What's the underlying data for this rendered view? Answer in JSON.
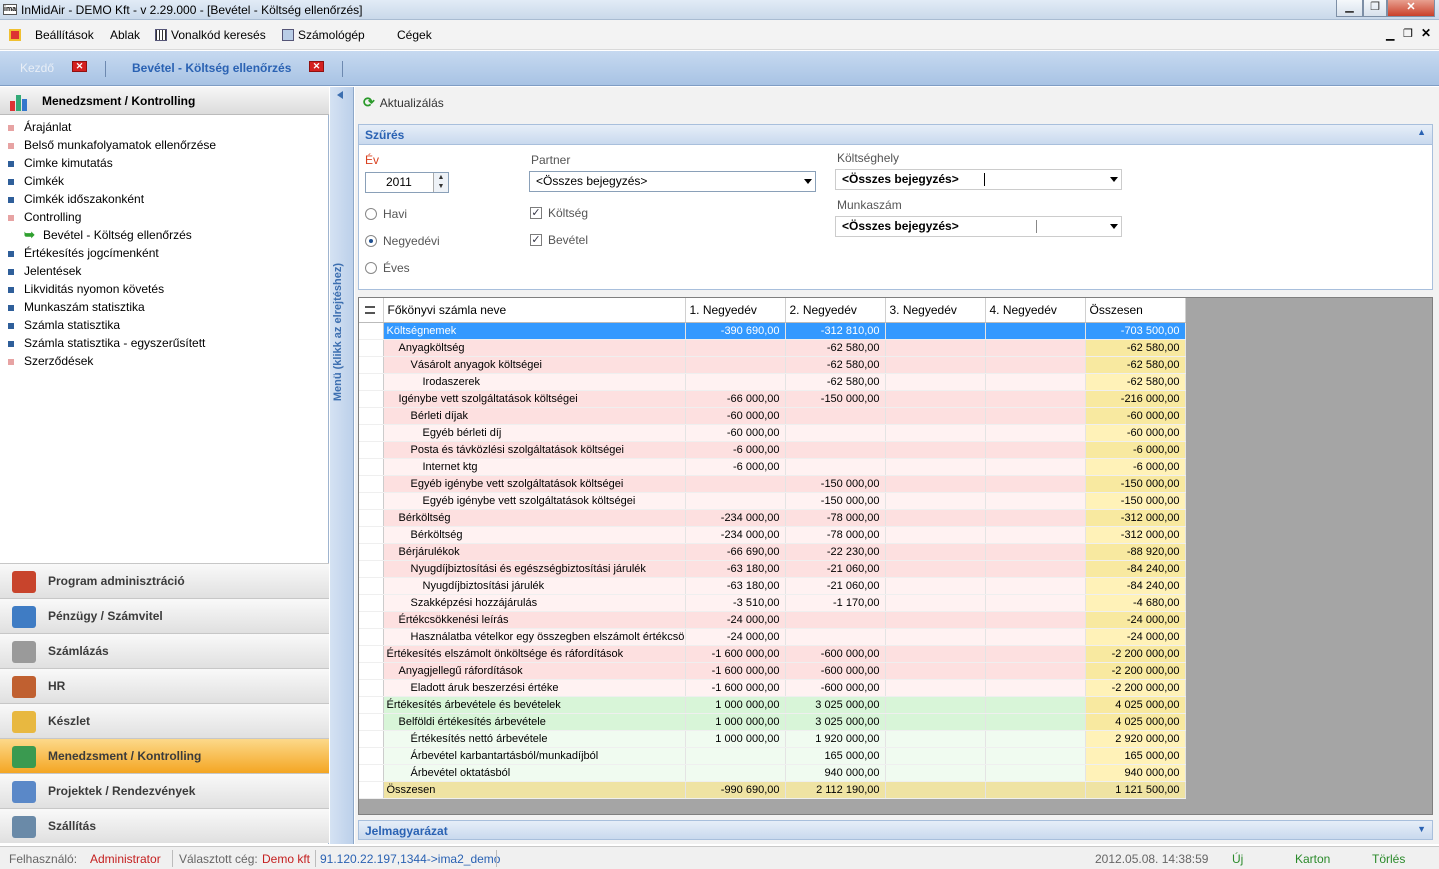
{
  "window": {
    "title": "InMidAir - DEMO Kft - v 2.29.000 - [Bevétel - Költség ellenőrzés]",
    "logo": "ima"
  },
  "menu": {
    "items": [
      "Beállítások",
      "Ablak",
      "Vonalkód keresés",
      "Számológép",
      "Cégek"
    ]
  },
  "tabs": [
    {
      "label": "Kezdő",
      "active": false
    },
    {
      "label": "Bevétel - Költség ellenőrzés",
      "active": true
    }
  ],
  "left": {
    "header": "Menedzsment / Kontrolling",
    "items": [
      {
        "label": "Árajánlat",
        "color": "#e7a3a3"
      },
      {
        "label": "Belső munkafolyamatok ellenőrzése",
        "color": "#e7a3a3"
      },
      {
        "label": "Cimke kimutatás",
        "color": "#2f5f9a"
      },
      {
        "label": "Cimkék",
        "color": "#2f5f9a"
      },
      {
        "label": "Cimkék időszakonként",
        "color": "#2f5f9a"
      },
      {
        "label": "Controlling",
        "color": "#e7a3a3"
      },
      {
        "label": "Bevétel - Költség ellenőrzés",
        "color": "#2fa02f"
      },
      {
        "label": "Értékesítés jogcímenként",
        "color": "#2f5f9a"
      },
      {
        "label": "Jelentések",
        "color": "#2f5f9a"
      },
      {
        "label": "Likviditás nyomon követés",
        "color": "#2f5f9a"
      },
      {
        "label": "Munkaszám statisztika",
        "color": "#2f5f9a"
      },
      {
        "label": "Számla statisztika",
        "color": "#2f5f9a"
      },
      {
        "label": "Számla statisztika - egyszerűsített",
        "color": "#2f5f9a"
      },
      {
        "label": "Szerződések",
        "color": "#e7a3a3"
      }
    ],
    "modules": [
      {
        "label": "Program adminisztráció",
        "icon": "home-icon",
        "active": false
      },
      {
        "label": "Pénzügy / Számvitel",
        "icon": "calculator-icon",
        "active": false
      },
      {
        "label": "Számlázás",
        "icon": "invoice-icon",
        "active": false
      },
      {
        "label": "HR",
        "icon": "people-icon",
        "active": false
      },
      {
        "label": "Készlet",
        "icon": "box-icon",
        "active": false
      },
      {
        "label": "Menedzsment / Kontrolling",
        "icon": "chart-icon",
        "active": true
      },
      {
        "label": "Projektek / Rendezvények",
        "icon": "project-icon",
        "active": false
      },
      {
        "label": "Szállítás",
        "icon": "truck-icon",
        "active": false
      }
    ]
  },
  "side_strip": "Menü (klikk az elrejtéshez)",
  "toolbar": {
    "refresh": "Aktualizálás"
  },
  "filter": {
    "title": "Szűrés",
    "year_label": "Év",
    "year_value": "2011",
    "partner_label": "Partner",
    "partner_value": "<Összes bejegyzés>",
    "ktghely_label": "Költséghely",
    "ktghely_value": "<Összes bejegyzés>",
    "munkaszam_label": "Munkaszám",
    "munkaszam_value": "<Összes bejegyzés>",
    "periods": [
      {
        "label": "Havi",
        "selected": false
      },
      {
        "label": "Negyedévi",
        "selected": true
      },
      {
        "label": "Éves",
        "selected": false
      }
    ],
    "checks": [
      {
        "label": "Költség",
        "checked": true
      },
      {
        "label": "Bevétel",
        "checked": true
      }
    ]
  },
  "grid": {
    "columns": [
      "Főkönyvi számla neve",
      "1. Negyedév",
      "2. Negyedév",
      "3. Negyedév",
      "4. Negyedév",
      "Összesen"
    ],
    "rows": [
      {
        "name": "Költségnemek",
        "lvl": 0,
        "q1": "-390 690,00",
        "q2": "-312 810,00",
        "q3": "",
        "q4": "",
        "sum": "-703 500,00",
        "style": "sel"
      },
      {
        "name": "Anyagköltség",
        "lvl": 1,
        "q1": "",
        "q2": "-62 580,00",
        "q3": "",
        "q4": "",
        "sum": "-62 580,00",
        "style": "r"
      },
      {
        "name": "Vásárolt anyagok költségei",
        "lvl": 2,
        "q1": "",
        "q2": "-62 580,00",
        "q3": "",
        "q4": "",
        "sum": "-62 580,00",
        "style": "r"
      },
      {
        "name": "Irodaszerek",
        "lvl": 3,
        "q1": "",
        "q2": "-62 580,00",
        "q3": "",
        "q4": "",
        "sum": "-62 580,00",
        "style": "pr"
      },
      {
        "name": "Igénybe vett szolgáltatások költségei",
        "lvl": 1,
        "q1": "-66 000,00",
        "q2": "-150 000,00",
        "q3": "",
        "q4": "",
        "sum": "-216 000,00",
        "style": "r"
      },
      {
        "name": "Bérleti díjak",
        "lvl": 2,
        "q1": "-60 000,00",
        "q2": "",
        "q3": "",
        "q4": "",
        "sum": "-60 000,00",
        "style": "r"
      },
      {
        "name": "Egyéb bérleti díj",
        "lvl": 3,
        "q1": "-60 000,00",
        "q2": "",
        "q3": "",
        "q4": "",
        "sum": "-60 000,00",
        "style": "pr"
      },
      {
        "name": "Posta és távközlési szolgáltatások költségei",
        "lvl": 2,
        "q1": "-6 000,00",
        "q2": "",
        "q3": "",
        "q4": "",
        "sum": "-6 000,00",
        "style": "r"
      },
      {
        "name": "Internet ktg",
        "lvl": 3,
        "q1": "-6 000,00",
        "q2": "",
        "q3": "",
        "q4": "",
        "sum": "-6 000,00",
        "style": "pr"
      },
      {
        "name": "Egyéb igénybe vett szolgáltatások költségei",
        "lvl": 2,
        "q1": "",
        "q2": "-150 000,00",
        "q3": "",
        "q4": "",
        "sum": "-150 000,00",
        "style": "r"
      },
      {
        "name": "Egyéb igénybe vett szolgáltatások költségei",
        "lvl": 3,
        "q1": "",
        "q2": "-150 000,00",
        "q3": "",
        "q4": "",
        "sum": "-150 000,00",
        "style": "pr"
      },
      {
        "name": "Bérköltség",
        "lvl": 1,
        "q1": "-234 000,00",
        "q2": "-78 000,00",
        "q3": "",
        "q4": "",
        "sum": "-312 000,00",
        "style": "r"
      },
      {
        "name": "Bérköltség",
        "lvl": 2,
        "q1": "-234 000,00",
        "q2": "-78 000,00",
        "q3": "",
        "q4": "",
        "sum": "-312 000,00",
        "style": "pr"
      },
      {
        "name": "Bérjárulékok",
        "lvl": 1,
        "q1": "-66 690,00",
        "q2": "-22 230,00",
        "q3": "",
        "q4": "",
        "sum": "-88 920,00",
        "style": "r"
      },
      {
        "name": "Nyugdíjbiztosítási és egészségbiztosítási járulék",
        "lvl": 2,
        "q1": "-63 180,00",
        "q2": "-21 060,00",
        "q3": "",
        "q4": "",
        "sum": "-84 240,00",
        "style": "r"
      },
      {
        "name": "Nyugdíjbiztosítási járulék",
        "lvl": 3,
        "q1": "-63 180,00",
        "q2": "-21 060,00",
        "q3": "",
        "q4": "",
        "sum": "-84 240,00",
        "style": "pr"
      },
      {
        "name": "Szakképzési hozzájárulás",
        "lvl": 2,
        "q1": "-3 510,00",
        "q2": "-1 170,00",
        "q3": "",
        "q4": "",
        "sum": "-4 680,00",
        "style": "pr"
      },
      {
        "name": "Értékcsökkenési leírás",
        "lvl": 1,
        "q1": "-24 000,00",
        "q2": "",
        "q3": "",
        "q4": "",
        "sum": "-24 000,00",
        "style": "r"
      },
      {
        "name": "Használatba vételkor egy összegben elszámolt értékcsök",
        "lvl": 2,
        "q1": "-24 000,00",
        "q2": "",
        "q3": "",
        "q4": "",
        "sum": "-24 000,00",
        "style": "pr"
      },
      {
        "name": "Értékesítés elszámolt önköltsége és ráfordítások",
        "lvl": 0,
        "q1": "-1 600 000,00",
        "q2": "-600 000,00",
        "q3": "",
        "q4": "",
        "sum": "-2 200 000,00",
        "style": "r"
      },
      {
        "name": "Anyagjellegű ráfordítások",
        "lvl": 1,
        "q1": "-1 600 000,00",
        "q2": "-600 000,00",
        "q3": "",
        "q4": "",
        "sum": "-2 200 000,00",
        "style": "r"
      },
      {
        "name": "Eladott áruk beszerzési értéke",
        "lvl": 2,
        "q1": "-1 600 000,00",
        "q2": "-600 000,00",
        "q3": "",
        "q4": "",
        "sum": "-2 200 000,00",
        "style": "pr"
      },
      {
        "name": "Értékesítés árbevétele és bevételek",
        "lvl": 0,
        "q1": "1 000 000,00",
        "q2": "3 025 000,00",
        "q3": "",
        "q4": "",
        "sum": "4 025 000,00",
        "style": "g"
      },
      {
        "name": "Belföldi értékesítés árbevétele",
        "lvl": 1,
        "q1": "1 000 000,00",
        "q2": "3 025 000,00",
        "q3": "",
        "q4": "",
        "sum": "4 025 000,00",
        "style": "g"
      },
      {
        "name": "Értékesítés nettó árbevétele",
        "lvl": 2,
        "q1": "1 000 000,00",
        "q2": "1 920 000,00",
        "q3": "",
        "q4": "",
        "sum": "2 920 000,00",
        "style": "pg"
      },
      {
        "name": "Árbevétel karbantartásból/munkadíjból",
        "lvl": 2,
        "q1": "",
        "q2": "165 000,00",
        "q3": "",
        "q4": "",
        "sum": "165 000,00",
        "style": "pg"
      },
      {
        "name": "Árbevétel oktatásból",
        "lvl": 2,
        "q1": "",
        "q2": "940 000,00",
        "q3": "",
        "q4": "",
        "sum": "940 000,00",
        "style": "pg"
      },
      {
        "name": "Összesen",
        "lvl": 0,
        "q1": "-990 690,00",
        "q2": "2 112 190,00",
        "q3": "",
        "q4": "",
        "sum": "1 121 500,00",
        "style": "tot"
      }
    ]
  },
  "legend": {
    "title": "Jelmagyarázat"
  },
  "status": {
    "user_label": "Felhasználó:",
    "user": "Administrator",
    "company_label": "Választott cég:",
    "company": "Demo kft",
    "server": "91.120.22.197,1344->ima2_demo",
    "datetime": "2012.05.08. 14:38:59",
    "actions": [
      "Új",
      "Karton",
      "Törlés"
    ]
  }
}
